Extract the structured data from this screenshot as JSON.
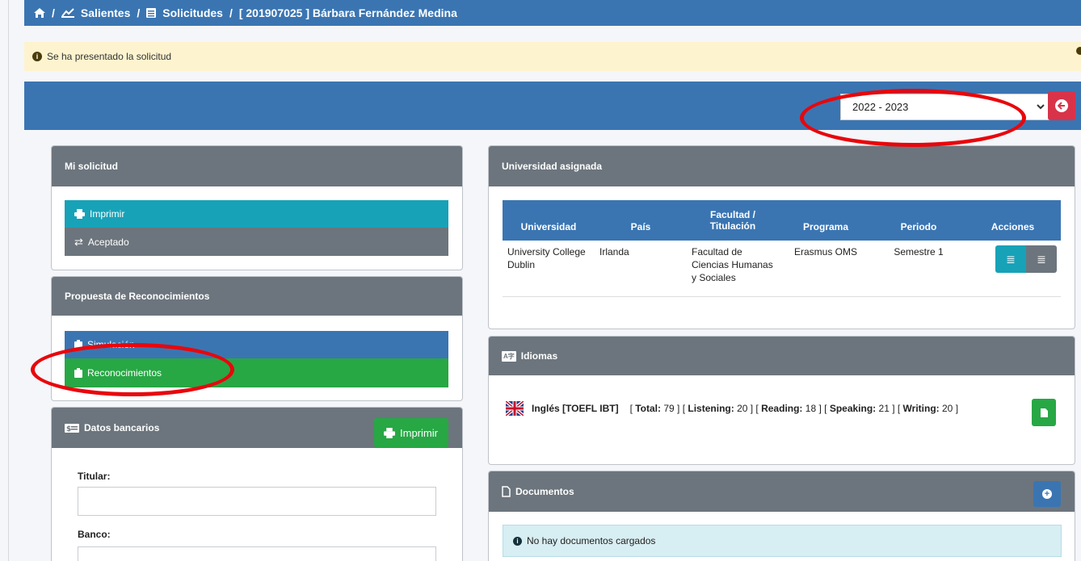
{
  "breadcrumb": {
    "items": [
      "Salientes",
      "Solicitudes",
      "[ 201907025 ] Bárbara Fernández Medina"
    ]
  },
  "alert": {
    "text": "Se ha presentado la solicitud"
  },
  "year_select": {
    "value": "2022 - 2023"
  },
  "mi_solicitud": {
    "title": "Mi solicitud",
    "imprimir": "Imprimir",
    "aceptado": "Aceptado"
  },
  "propuesta": {
    "title": "Propuesta de Reconocimientos",
    "simulacion": "Simulación",
    "reconocimientos": "Reconocimientos"
  },
  "datos_bancarios": {
    "title": "Datos bancarios",
    "imprimir": "Imprimir",
    "titular_label": "Titular:",
    "banco_label": "Banco:"
  },
  "universidad": {
    "title": "Universidad asignada",
    "headers": [
      "Universidad",
      "País",
      "Facultad / Titulación",
      "Programa",
      "Periodo",
      "Acciones"
    ],
    "row": [
      "University College Dublin",
      "Irlanda",
      "Facultad de Ciencias Humanas y Sociales",
      "Erasmus OMS",
      "Semestre 1"
    ]
  },
  "idiomas": {
    "title": "Idiomas",
    "language": "Inglés [TOEFL IBT]",
    "total_label": "Total:",
    "total": "79",
    "listening_label": "Listening:",
    "listening": "20",
    "reading_label": "Reading:",
    "reading": "18",
    "speaking_label": "Speaking:",
    "speaking": "21",
    "writing_label": "Writing:",
    "writing": "20"
  },
  "documentos": {
    "title": "Documentos",
    "empty": "No hay documentos cargados"
  },
  "colors": {
    "primary": "#3a75b2",
    "header_gray": "#6c757d",
    "teal": "#17a2b8",
    "success": "#28a745",
    "danger": "#d9334a",
    "highlight_ring": "#e8070c"
  }
}
